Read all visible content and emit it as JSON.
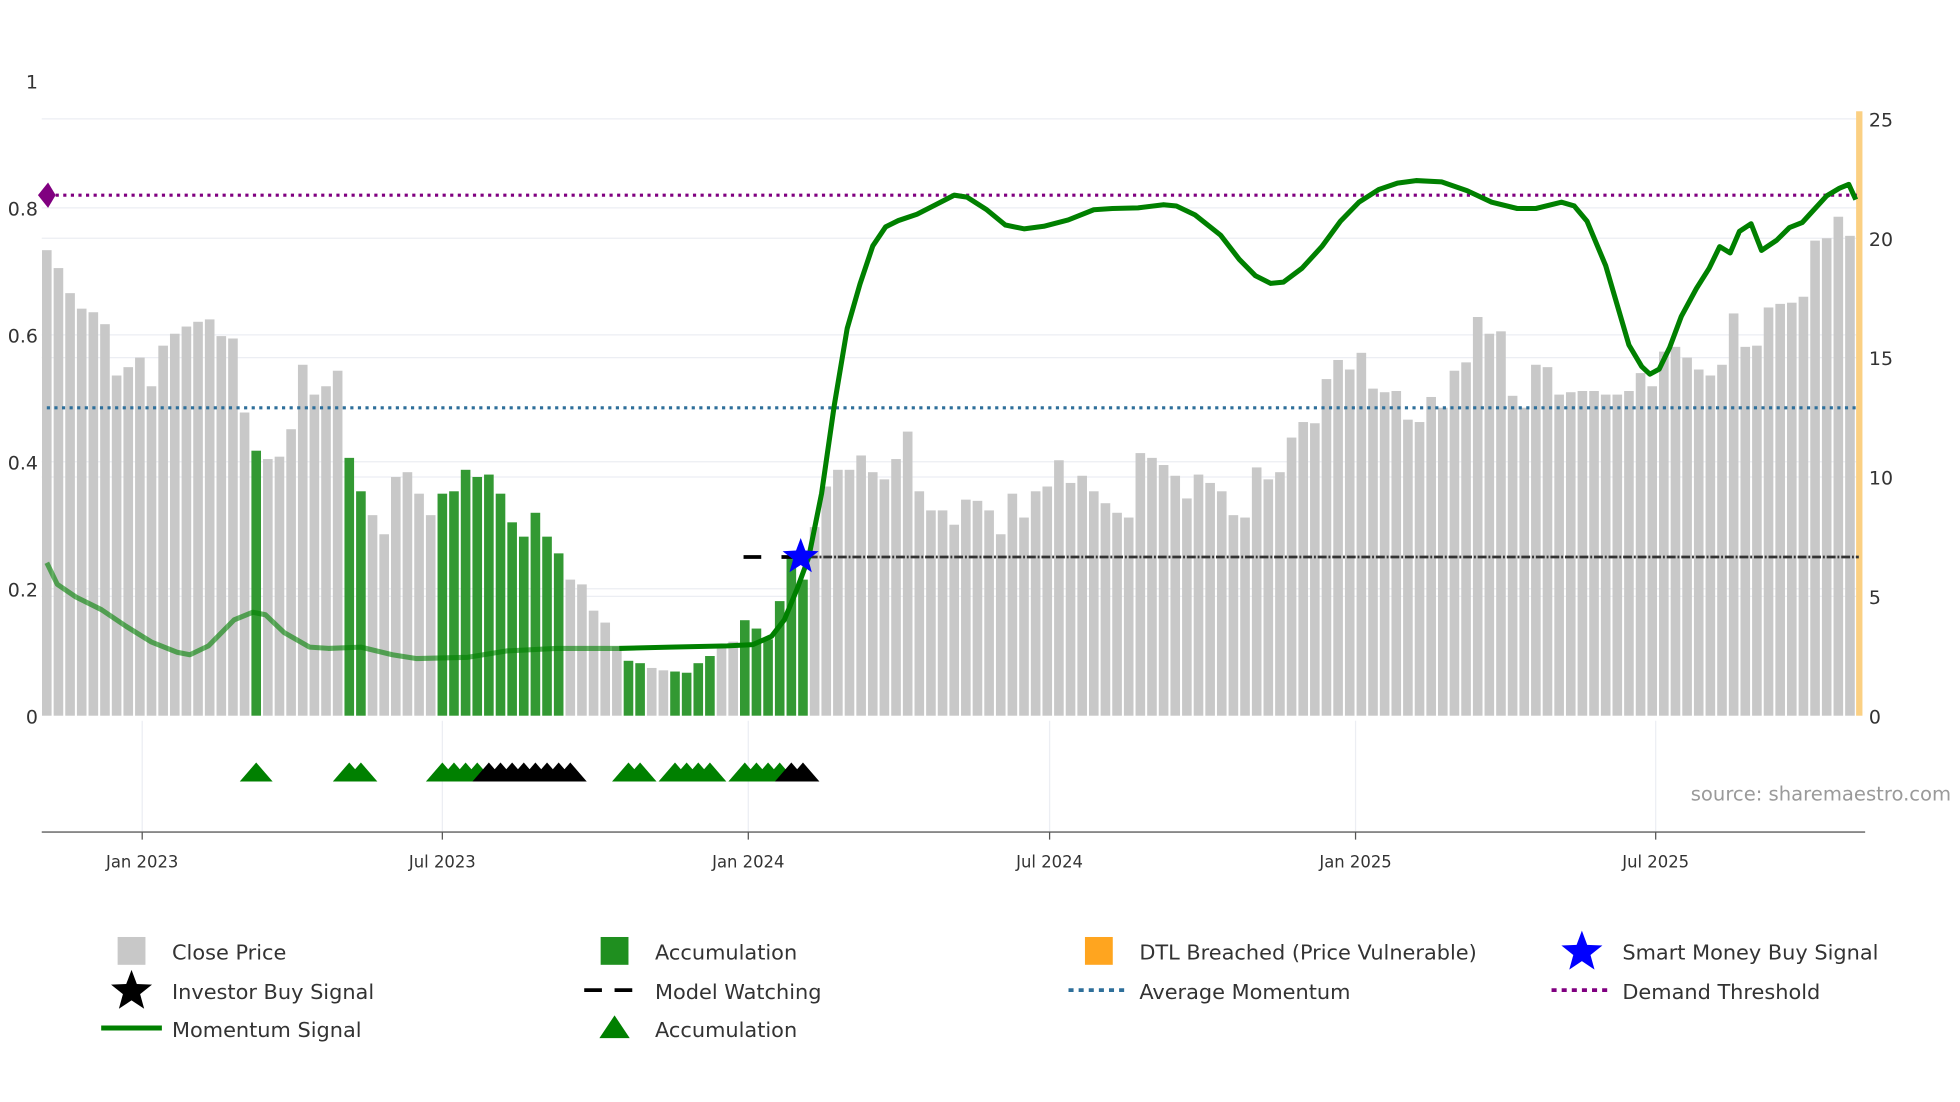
{
  "chart_data": {
    "type": "bar",
    "title": "",
    "source": "source: sharemaestro.com",
    "left_axis": {
      "range": [
        0,
        1
      ],
      "ticks": [
        "0",
        "0.2",
        "0.4",
        "0.6",
        "0.8",
        "1"
      ],
      "tick_values": [
        0,
        0.2,
        0.4,
        0.6,
        0.8,
        1
      ]
    },
    "right_axis": {
      "range": [
        0,
        25
      ],
      "ticks": [
        "0",
        "5",
        "10",
        "15",
        "20",
        "25"
      ],
      "tick_values": [
        0,
        5,
        10,
        15,
        20,
        25
      ]
    },
    "x_axis": {
      "unit": "week index",
      "ticks": [
        {
          "label": "Jan 2023",
          "week": 8.2
        },
        {
          "label": "Jul 2023",
          "week": 34.0
        },
        {
          "label": "Jan 2024",
          "week": 60.3
        },
        {
          "label": "Jul 2024",
          "week": 86.2
        },
        {
          "label": "Jan 2025",
          "week": 112.5
        },
        {
          "label": "Jul 2025",
          "week": 138.3
        }
      ]
    },
    "close_price": [
      19.5,
      18.75,
      17.7,
      17.05,
      16.9,
      16.4,
      14.25,
      14.6,
      15.0,
      13.8,
      15.5,
      16.0,
      16.3,
      16.5,
      16.6,
      15.9,
      15.8,
      12.7,
      11.1,
      10.75,
      10.85,
      12.0,
      14.7,
      13.45,
      13.8,
      14.45,
      10.8,
      9.4,
      8.4,
      7.6,
      10.0,
      10.2,
      9.3,
      8.4,
      9.3,
      9.4,
      10.3,
      10.0,
      10.1,
      9.3,
      8.1,
      7.5,
      8.5,
      7.5,
      6.8,
      5.7,
      5.5,
      4.4,
      3.9,
      2.9,
      2.3,
      2.2,
      2.0,
      1.9,
      1.85,
      1.8,
      2.2,
      2.5,
      3.0,
      3.1,
      4.0,
      3.65,
      3.2,
      4.8,
      6.7,
      5.7,
      7.9,
      9.6,
      10.3,
      10.3,
      10.9,
      10.2,
      9.9,
      10.75,
      11.9,
      9.4,
      8.6,
      8.6,
      8.0,
      9.05,
      9.0,
      8.6,
      7.6,
      9.3,
      8.3,
      9.4,
      9.6,
      10.7,
      9.75,
      10.05,
      9.4,
      8.9,
      8.5,
      8.3,
      11.0,
      10.8,
      10.5,
      10.05,
      9.1,
      10.1,
      9.75,
      9.4,
      8.4,
      8.3,
      10.4,
      9.9,
      10.2,
      11.65,
      12.3,
      12.25,
      14.1,
      14.9,
      14.5,
      15.2,
      13.7,
      13.55,
      13.6,
      12.4,
      12.3,
      13.35,
      12.9,
      14.45,
      14.8,
      16.7,
      16.0,
      16.1,
      13.4,
      12.9,
      14.7,
      14.6,
      13.45,
      13.55,
      13.6,
      13.6,
      13.45,
      13.45,
      13.6,
      14.35,
      13.8,
      15.25,
      15.45,
      15.0,
      14.5,
      14.25,
      14.7,
      16.85,
      15.45,
      15.5,
      17.1,
      17.25,
      17.3,
      17.55,
      19.9,
      20.0,
      20.9,
      20.1
    ],
    "accumulation_weeks": [
      18,
      26,
      27,
      34,
      35,
      36,
      37,
      38,
      39,
      40,
      41,
      42,
      43,
      44,
      50,
      51,
      54,
      55,
      56,
      57,
      60,
      61,
      62,
      63,
      64,
      65
    ],
    "momentum_signal": [
      [
        0,
        0.241
      ],
      [
        0.9,
        0.207
      ],
      [
        2.5,
        0.187
      ],
      [
        4.7,
        0.167
      ],
      [
        6.8,
        0.141
      ],
      [
        9.0,
        0.116
      ],
      [
        11.2,
        0.1
      ],
      [
        12.3,
        0.096
      ],
      [
        13.9,
        0.11
      ],
      [
        16.1,
        0.151
      ],
      [
        17.7,
        0.163
      ],
      [
        18.8,
        0.159
      ],
      [
        20.4,
        0.131
      ],
      [
        22.6,
        0.108
      ],
      [
        24.2,
        0.106
      ],
      [
        27.0,
        0.108
      ],
      [
        29.7,
        0.096
      ],
      [
        31.8,
        0.09
      ],
      [
        36.2,
        0.092
      ],
      [
        39.5,
        0.102
      ],
      [
        43.8,
        0.106
      ],
      [
        49.2,
        0.106
      ],
      [
        53.6,
        0.108
      ],
      [
        58.5,
        0.11
      ],
      [
        60.7,
        0.112
      ],
      [
        62.3,
        0.125
      ],
      [
        63.4,
        0.151
      ],
      [
        64.5,
        0.2
      ],
      [
        65.5,
        0.25
      ],
      [
        66.6,
        0.35
      ],
      [
        67.7,
        0.49
      ],
      [
        68.8,
        0.61
      ],
      [
        69.9,
        0.68
      ],
      [
        71.0,
        0.74
      ],
      [
        72.1,
        0.77
      ],
      [
        73.2,
        0.78
      ],
      [
        74.8,
        0.79
      ],
      [
        76.4,
        0.805
      ],
      [
        78.0,
        0.82
      ],
      [
        79.1,
        0.817
      ],
      [
        80.8,
        0.797
      ],
      [
        82.4,
        0.773
      ],
      [
        84.0,
        0.767
      ],
      [
        85.7,
        0.771
      ],
      [
        87.8,
        0.781
      ],
      [
        90.0,
        0.797
      ],
      [
        91.6,
        0.799
      ],
      [
        93.8,
        0.8
      ],
      [
        96.0,
        0.805
      ],
      [
        97.1,
        0.803
      ],
      [
        98.7,
        0.789
      ],
      [
        100.9,
        0.757
      ],
      [
        102.5,
        0.719
      ],
      [
        103.9,
        0.693
      ],
      [
        105.2,
        0.681
      ],
      [
        106.3,
        0.683
      ],
      [
        107.9,
        0.705
      ],
      [
        109.6,
        0.739
      ],
      [
        111.2,
        0.779
      ],
      [
        112.8,
        0.809
      ],
      [
        114.5,
        0.829
      ],
      [
        116.1,
        0.839
      ],
      [
        117.7,
        0.843
      ],
      [
        119.9,
        0.841
      ],
      [
        122.1,
        0.827
      ],
      [
        124.2,
        0.809
      ],
      [
        126.4,
        0.799
      ],
      [
        128.0,
        0.799
      ],
      [
        130.2,
        0.809
      ],
      [
        131.3,
        0.803
      ],
      [
        132.4,
        0.779
      ],
      [
        134.0,
        0.709
      ],
      [
        136.0,
        0.584
      ],
      [
        137.1,
        0.55
      ],
      [
        137.8,
        0.538
      ],
      [
        138.6,
        0.546
      ],
      [
        139.5,
        0.58
      ],
      [
        140.5,
        0.629
      ],
      [
        141.8,
        0.673
      ],
      [
        142.9,
        0.705
      ],
      [
        143.8,
        0.739
      ],
      [
        144.7,
        0.729
      ],
      [
        145.5,
        0.763
      ],
      [
        146.5,
        0.775
      ],
      [
        147.4,
        0.733
      ],
      [
        148.7,
        0.749
      ],
      [
        149.8,
        0.769
      ],
      [
        150.9,
        0.777
      ],
      [
        152.0,
        0.799
      ],
      [
        153.0,
        0.819
      ],
      [
        154.1,
        0.831
      ],
      [
        154.9,
        0.837
      ],
      [
        155.5,
        0.813
      ]
    ],
    "momentum_faded_until_week": 48,
    "average_momentum": 0.485,
    "demand_threshold": 0.82,
    "model_watching": {
      "value": 0.25,
      "start_week": 60.5,
      "solid_from_week": 65.5
    },
    "smart_money_buy_signal": {
      "week": 64.8,
      "value": 0.25
    },
    "dtl_breached_week": 155.8,
    "accumulation_markers_weeks": [
      18,
      26,
      27,
      34,
      35,
      36,
      37,
      50,
      51,
      54,
      55,
      56,
      57,
      60,
      61,
      62,
      63
    ],
    "investor_buy_markers_weeks": [
      38,
      39,
      40,
      41,
      42,
      43,
      44,
      45,
      64,
      65
    ],
    "legend": [
      {
        "label": "Close Price",
        "icon": "grey-bar"
      },
      {
        "label": "Accumulation",
        "icon": "green-bar"
      },
      {
        "label": "DTL Breached (Price Vulnerable)",
        "icon": "orange-bar"
      },
      {
        "label": "Smart Money Buy Signal",
        "icon": "blue-star"
      },
      {
        "label": "Investor Buy Signal",
        "icon": "black-star"
      },
      {
        "label": "Model Watching",
        "icon": "black-dash"
      },
      {
        "label": "Average Momentum",
        "icon": "blue-dotted-line"
      },
      {
        "label": "Demand Threshold",
        "icon": "purple-dotted-line"
      },
      {
        "label": "Momentum Signal",
        "icon": "green-line"
      },
      {
        "label": "Accumulation",
        "icon": "green-triangle"
      }
    ],
    "legend_placement": "bottom",
    "colors": {
      "price": "#c8c8c8",
      "accumulation": "#339933",
      "momentum": "#008000",
      "dtl": "#fbd083",
      "smart_money": "#0000ff",
      "avg_momentum": "#2e6f9a",
      "demand": "#800080",
      "investor": "#000000"
    }
  }
}
